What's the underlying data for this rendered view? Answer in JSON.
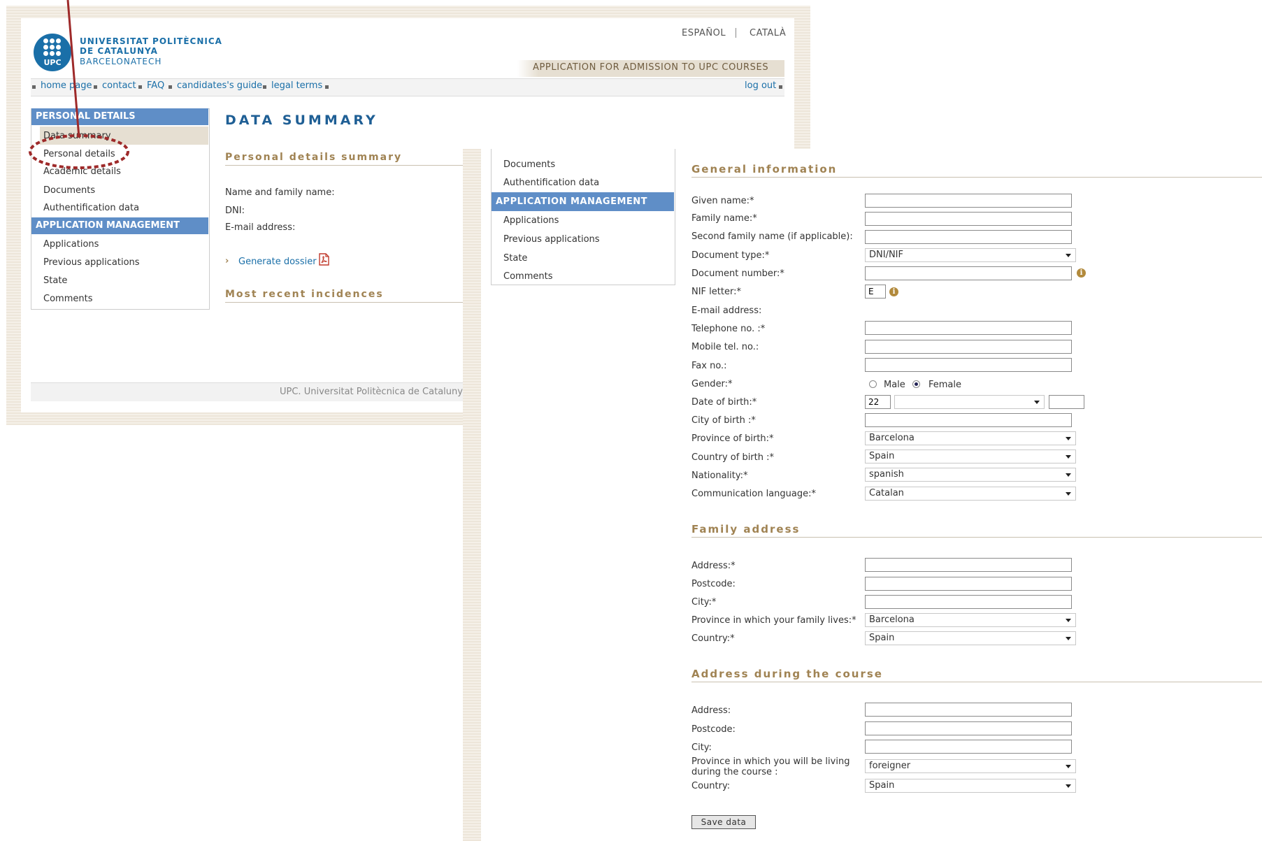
{
  "header": {
    "logo_text": "UPC",
    "university_line1": "UNIVERSITAT POLITÈCNICA",
    "university_line2": "DE CATALUNYA",
    "university_line3": "BARCELONATECH",
    "languages": [
      "ESPAÑOL",
      "CATALÀ"
    ],
    "app_title": "APPLICATION FOR ADMISSION TO UPC COURSES"
  },
  "nav": {
    "links": [
      "home page",
      "contact",
      "FAQ",
      "candidates's guide",
      "legal terms"
    ],
    "logout": "log out"
  },
  "sidebar": {
    "personal_header": "PERSONAL DETAILS",
    "personal_items": [
      "Data summary",
      "Personal details",
      "Academic details",
      "Documents",
      "Authentification data"
    ],
    "application_header": "APPLICATION MANAGEMENT",
    "application_items": [
      "Applications",
      "Previous applications",
      "State",
      "Comments"
    ]
  },
  "summary": {
    "title": "DATA SUMMARY",
    "personal_section": "Personal details summary",
    "fields": [
      "Name and family name:",
      "DNI:",
      "E-mail address:"
    ],
    "generate_link": "Generate dossier",
    "incidences_section": "Most recent incidences",
    "footer": "UPC. Universitat Politècnica de Catalunya"
  },
  "form": {
    "general_section": "General information",
    "labels": {
      "given_name": "Given name:*",
      "family_name": "Family name:*",
      "second_family_name": "Second family name (if applicable):",
      "document_type": "Document type:*",
      "document_number": "Document number:*",
      "nif_letter": "NIF letter:*",
      "email": "E-mail address:",
      "telephone": "Telephone no. :*",
      "mobile": "Mobile tel. no.:",
      "fax": "Fax no.:",
      "gender": "Gender:*",
      "date_of_birth": "Date of birth:*",
      "city_of_birth": "City of birth :*",
      "province_of_birth": "Province of birth:*",
      "country_of_birth": "Country of birth :*",
      "nationality": "Nationality:*",
      "communication_language": "Communication language:*"
    },
    "values": {
      "document_type": "DNI/NIF",
      "nif_letter": "E",
      "birth_day": "22",
      "province_of_birth": "Barcelona",
      "country_of_birth": "Spain",
      "nationality": "spanish",
      "communication_language": "Catalan"
    },
    "gender_options": [
      "Male",
      "Female"
    ],
    "gender_selected": "Female",
    "family_section": "Family address",
    "family_labels": {
      "address": "Address:*",
      "postcode": "Postcode:",
      "city": "City:*",
      "province": "Province in which your family lives:*",
      "country": "Country:*"
    },
    "family_values": {
      "province": "Barcelona",
      "country": "Spain"
    },
    "course_section": "Address during the course",
    "course_labels": {
      "address": "Address:",
      "postcode": "Postcode:",
      "city": "City:",
      "province_line1": "Province in which you will be living",
      "province_line2": "during the course :",
      "country": "Country:"
    },
    "course_values": {
      "province": "foreigner",
      "country": "Spain"
    },
    "save_button": "Save data"
  },
  "icons": {
    "pdf": "pdf-icon",
    "info": "info-icon",
    "annotation": "highlight-circle"
  },
  "colors": {
    "brand_blue": "#1a6fa8",
    "sidebar_header": "#5f8ec7",
    "section_gold": "#a08353",
    "annotation_red": "#9e2a2a"
  }
}
